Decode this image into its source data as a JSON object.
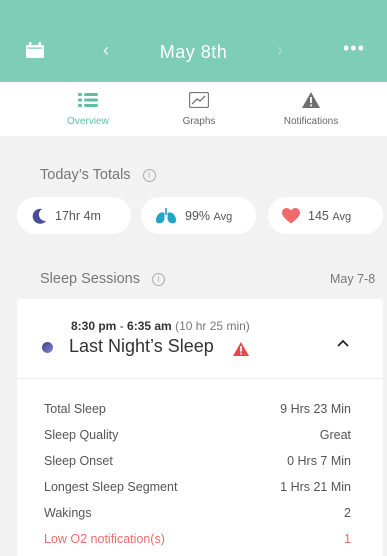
{
  "header": {
    "title": "May 8th",
    "prev": "‹",
    "next": "›",
    "more": "•••",
    "calendar_icon": "calendar-icon",
    "accent": "#7ecdb7"
  },
  "tabs": [
    {
      "label": "Overview",
      "icon": "list-icon",
      "active": true
    },
    {
      "label": "Graphs",
      "icon": "chart-icon",
      "active": false
    },
    {
      "label": "Notifications",
      "icon": "warning-icon",
      "active": false
    }
  ],
  "totals": {
    "title": "Today’s Totals",
    "info": "i",
    "sleep": {
      "value": "17hr 4m",
      "icon": "moon-icon"
    },
    "oxygen": {
      "value": "99%",
      "suffix": "Avg",
      "icon": "lungs-icon"
    },
    "heart": {
      "value": "145",
      "suffix": "Avg",
      "icon": "heart-icon"
    }
  },
  "sessions": {
    "title": "Sleep Sessions",
    "info": "i",
    "date_range": "May 7-8",
    "card": {
      "start": "8:30 pm",
      "separator": " - ",
      "end": "6:35 am",
      "duration": "(10 hr 25 min)",
      "name": "Last Night’s Sleep",
      "rows": [
        {
          "label": "Total Sleep",
          "value": "9 Hrs 23 Min"
        },
        {
          "label": "Sleep Quality",
          "value": "Great"
        },
        {
          "label": "Sleep Onset",
          "value": "0 Hrs  7 Min"
        },
        {
          "label": "Longest Sleep Segment",
          "value": "1 Hrs  21 Min"
        },
        {
          "label": "Wakings",
          "value": "2"
        },
        {
          "label": "Low O2 notification(s)",
          "value": "1"
        }
      ]
    }
  }
}
